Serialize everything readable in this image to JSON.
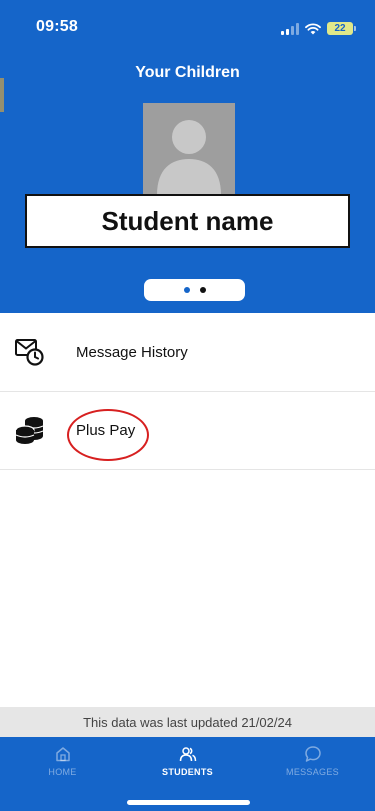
{
  "status_bar": {
    "time": "09:58",
    "battery_level": "22"
  },
  "header": {
    "title": "Your Children",
    "student_name": "Student name",
    "pager": {
      "total_pages": 2,
      "active_page": 1
    }
  },
  "menu": {
    "items": [
      {
        "label": "Message History",
        "icon": "message-history-icon"
      },
      {
        "label": "Plus Pay",
        "icon": "coins-icon"
      }
    ]
  },
  "footer": {
    "update_text": "This data was last updated 21/02/24"
  },
  "tabbar": {
    "tabs": [
      {
        "label": "HOME",
        "icon": "home-icon",
        "active": false
      },
      {
        "label": "STUDENTS",
        "icon": "students-icon",
        "active": true
      },
      {
        "label": "MESSAGES",
        "icon": "message-bubble-icon",
        "active": false
      }
    ]
  },
  "colors": {
    "brand_blue": "#1565c9",
    "annotation_red": "#d72020",
    "avatar_gray": "#9e9e9e"
  }
}
